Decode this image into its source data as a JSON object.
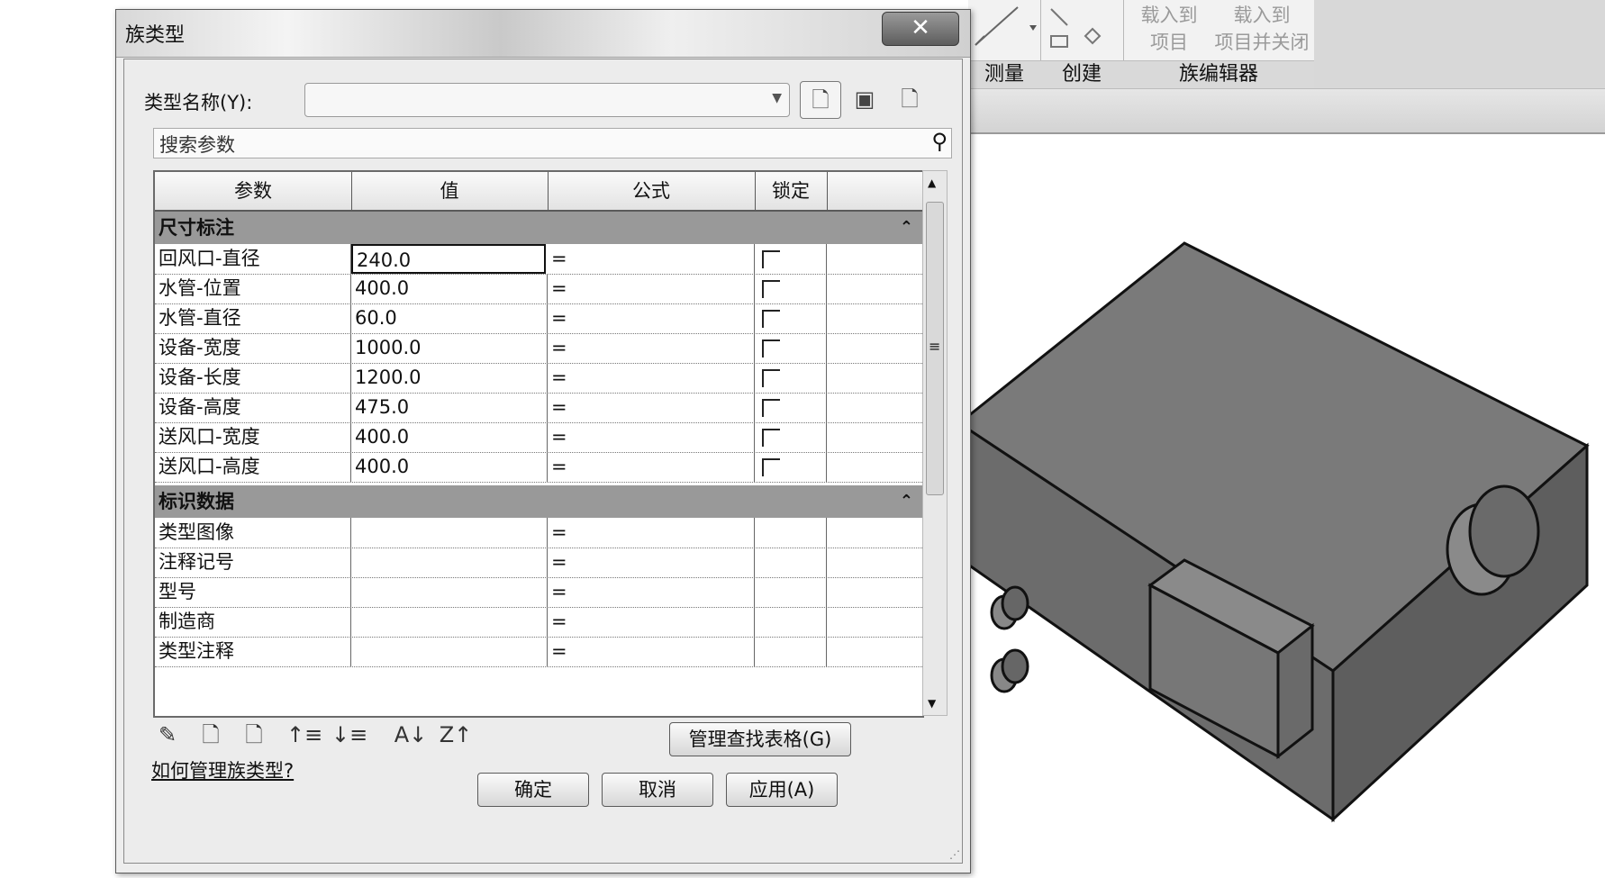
{
  "dialog": {
    "title": "族类型",
    "close_symbol": "✕",
    "type_name_label": "类型名称(Y):",
    "type_name_value": "",
    "search_placeholder": "搜索参数",
    "columns": [
      "参数",
      "值",
      "公式",
      "锁定"
    ],
    "groups": [
      {
        "name": "尺寸标注",
        "rows": [
          {
            "param": "回风口-直径",
            "value": "240.0",
            "formula": "=",
            "locked": false
          },
          {
            "param": "水管-位置",
            "value": "400.0",
            "formula": "=",
            "locked": false
          },
          {
            "param": "水管-直径",
            "value": "60.0",
            "formula": "=",
            "locked": false
          },
          {
            "param": "设备-宽度",
            "value": "1000.0",
            "formula": "=",
            "locked": false
          },
          {
            "param": "设备-长度",
            "value": "1200.0",
            "formula": "=",
            "locked": false
          },
          {
            "param": "设备-高度",
            "value": "475.0",
            "formula": "=",
            "locked": false
          },
          {
            "param": "送风口-宽度",
            "value": "400.0",
            "formula": "=",
            "locked": false
          },
          {
            "param": "送风口-高度",
            "value": "400.0",
            "formula": "=",
            "locked": false
          }
        ]
      },
      {
        "name": "标识数据",
        "rows": [
          {
            "param": "类型图像",
            "value": "",
            "formula": "="
          },
          {
            "param": "注释记号",
            "value": "",
            "formula": "="
          },
          {
            "param": "型号",
            "value": "",
            "formula": "="
          },
          {
            "param": "制造商",
            "value": "",
            "formula": "="
          },
          {
            "param": "类型注释",
            "value": "",
            "formula": "="
          }
        ]
      }
    ],
    "manage_lookup_label": "管理查找表格(G)",
    "help_link": "如何管理族类型?",
    "ok_label": "确定",
    "cancel_label": "取消",
    "apply_label": "应用(A)"
  },
  "ribbon": {
    "load_into_project": "载入到\n项目",
    "load_into_project_close": "载入到\n项目并关闭",
    "group_measure": "测量",
    "group_create": "创建",
    "group_family_editor": "族编辑器"
  }
}
